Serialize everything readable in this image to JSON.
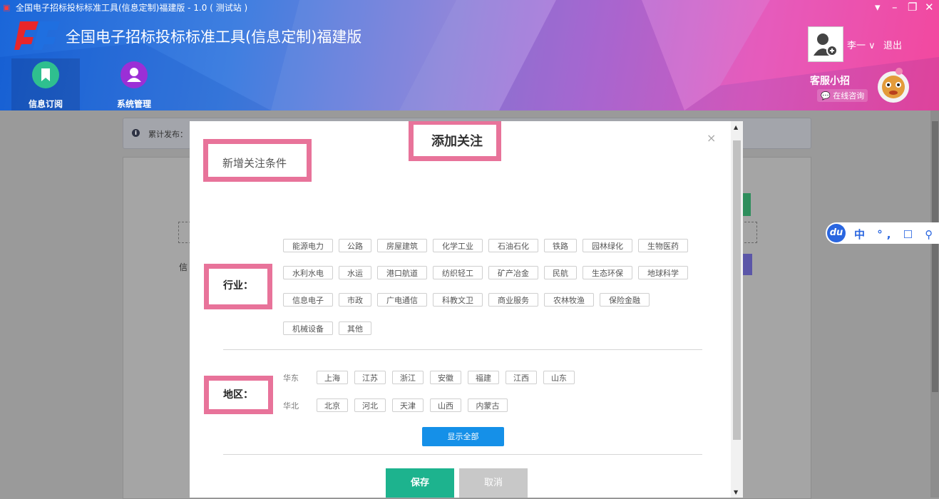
{
  "window": {
    "title": "全国电子招标投标标准工具(信息定制)福建版 - 1.0 ( 测试站 )",
    "controls": [
      "▾",
      "–",
      "❐",
      "✕"
    ]
  },
  "header": {
    "app_title": "全国电子招标投标标准工具(信息定制)福建版",
    "nav": [
      {
        "label": "信息订阅",
        "icon": "bookmark-icon",
        "color": "#2fbf8f"
      },
      {
        "label": "系统管理",
        "icon": "user-icon",
        "color": "#9b2fd6"
      }
    ],
    "user": {
      "name": "李一 ∨",
      "logout": "退出"
    },
    "customer_service": {
      "title": "客服小招",
      "online": "在线咨询"
    }
  },
  "background": {
    "info_bar_text": "累计发布：",
    "side_label": "信"
  },
  "ime": {
    "text": "中 °, ☐ ⚲ ▦"
  },
  "modal": {
    "title": "添加关注",
    "close": "×",
    "subtitle": "新增关注条件",
    "industry_label": "行业：",
    "industries": [
      [
        "能源电力",
        "公路",
        "房屋建筑",
        "化学工业",
        "石油石化",
        "铁路",
        "园林绿化",
        "生物医药"
      ],
      [
        "水利水电",
        "水运",
        "港口航道",
        "纺织轻工",
        "矿产冶金",
        "民航",
        "生态环保",
        "地球科学"
      ],
      [
        "信息电子",
        "市政",
        "广电通信",
        "科教文卫",
        "商业服务",
        "农林牧渔",
        "保险金融"
      ],
      [
        "机械设备",
        "其他"
      ]
    ],
    "region_label": "地区：",
    "regions": [
      {
        "name": "华东",
        "items": [
          "上海",
          "江苏",
          "浙江",
          "安徽",
          "福建",
          "江西",
          "山东"
        ]
      },
      {
        "name": "华北",
        "items": [
          "北京",
          "河北",
          "天津",
          "山西",
          "内蒙古"
        ]
      }
    ],
    "show_all": "显示全部",
    "save": "保存",
    "cancel": "取消"
  },
  "colors": {
    "highlight": "#e8739a",
    "save": "#1db38e",
    "show_all": "#1590e8"
  }
}
